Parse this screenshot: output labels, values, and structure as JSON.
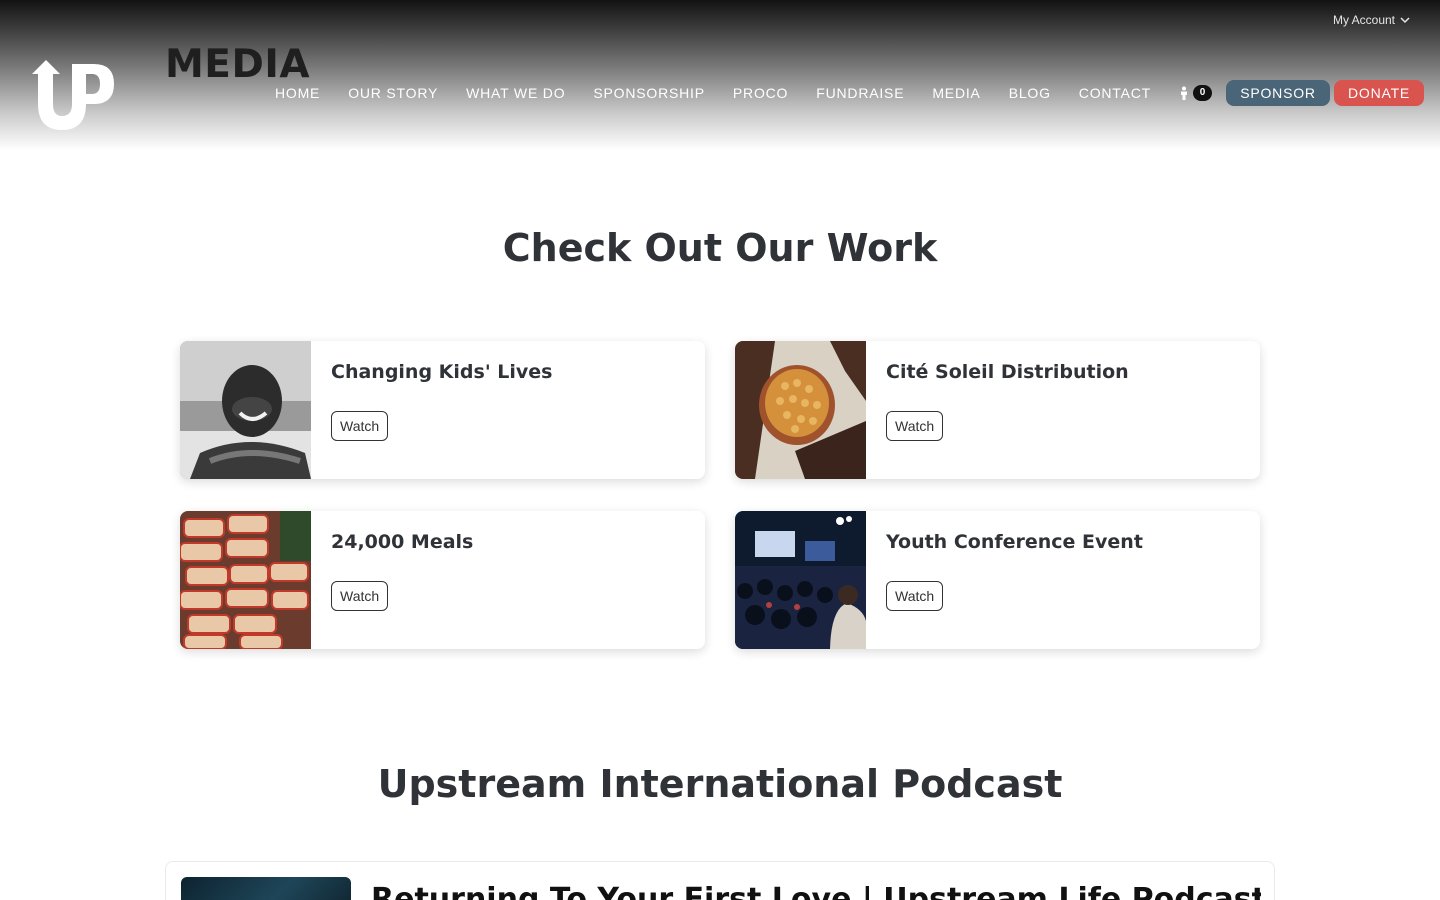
{
  "header": {
    "account_label": "My Account",
    "page_title": "MEDIA",
    "logo_letters": "UP",
    "nav": [
      "HOME",
      "OUR STORY",
      "WHAT WE DO",
      "SPONSORSHIP",
      "PROCO",
      "FUNDRAISE",
      "MEDIA",
      "BLOG",
      "CONTACT"
    ],
    "cart_count": "0",
    "sponsor_label": "SPONSOR",
    "donate_label": "DONATE",
    "colors": {
      "sponsor": "#4a6478",
      "donate": "#d9534f"
    }
  },
  "work": {
    "title": "Check Out Our Work",
    "cards": [
      {
        "title": "Changing Kids' Lives",
        "button": "Watch",
        "image_icon": "smiling-child-photo"
      },
      {
        "title": "Cité Soleil Distribution",
        "button": "Watch",
        "image_icon": "corn-kernels-photo"
      },
      {
        "title": "24,000 Meals",
        "button": "Watch",
        "image_icon": "meal-bags-photo"
      },
      {
        "title": "Youth Conference Event",
        "button": "Watch",
        "image_icon": "conference-crowd-photo"
      }
    ]
  },
  "podcast": {
    "title": "Upstream International Podcast",
    "episode_title": "Returning To Your First Love | Upstream Life Podcast"
  }
}
